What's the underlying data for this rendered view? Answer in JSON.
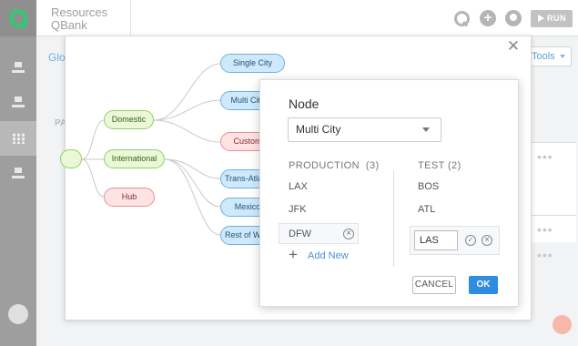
{
  "header": {
    "app_title_line1": "Resources",
    "app_title_line2": "QBank",
    "plus_glyph": "+",
    "run_label": "RUN",
    "icons": [
      "search-icon",
      "plus-circle-icon",
      "moon-icon"
    ]
  },
  "background": {
    "tab_label": "Glo",
    "tools_label": "Tools",
    "column_initials": "PA",
    "row_dots": "•••"
  },
  "modal": {
    "close_glyph": "✕",
    "tree": {
      "root_label": "",
      "branches": [
        "Domestic",
        "International",
        "Hub"
      ],
      "leaves": [
        "Single City",
        "Multi City",
        "Custom",
        "Trans-Atlantic",
        "Mexico",
        "Rest of World"
      ]
    }
  },
  "dialog": {
    "title": "Node",
    "selected_node": "Multi City",
    "production": {
      "header": "PRODUCTION",
      "count": "(3)",
      "items": [
        "LAX",
        "JFK",
        "DFW"
      ]
    },
    "test": {
      "header": "TEST",
      "count": "(2)",
      "items": [
        "BOS",
        "ATL"
      ],
      "editing_value": "LAS"
    },
    "add_new_label": "Add New",
    "cancel_label": "CANCEL",
    "ok_label": "OK"
  },
  "colors": {
    "accent": "#2f8ce0",
    "green_node": "#ebf8d6",
    "blue_node": "#cfe9fb",
    "red_node": "#fde3e3"
  }
}
